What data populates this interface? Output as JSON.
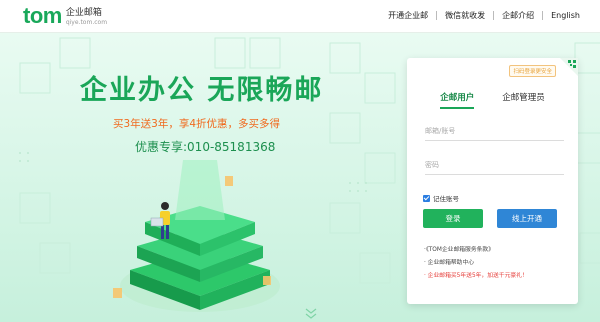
{
  "header": {
    "logo_word": "tom",
    "logo_cn": "企业邮箱",
    "logo_url": "qiye.tom.com",
    "nav": [
      {
        "label": "开通企业邮"
      },
      {
        "label": "微信就收发"
      },
      {
        "label": "企邮介绍"
      },
      {
        "label": "English"
      }
    ]
  },
  "banner": {
    "headline": "企业办公  无限畅邮",
    "promo": "买3年送3年，享4折优惠，多买多得",
    "hotline": "优惠专享:010-85181368"
  },
  "login": {
    "qr_badge": "扫码登录更安全",
    "tabs": [
      {
        "label": "企邮用户",
        "active": true
      },
      {
        "label": "企邮管理员",
        "active": false
      }
    ],
    "account_placeholder": "邮箱/账号",
    "password_placeholder": "密码",
    "remember_label": "记住账号",
    "remember_checked": true,
    "login_button": "登录",
    "open_button": "线上开通",
    "links": [
      {
        "text": "·《TOM企业邮箱服务条款》",
        "color": "#444444"
      },
      {
        "text": "· 企业邮箱帮助中心",
        "color": "#444444"
      },
      {
        "text": "· 企业邮箱买5年送5年，加送千元豪礼！",
        "color": "#e53935"
      }
    ]
  },
  "colors": {
    "brand_green": "#1aa658",
    "promo_orange": "#f06a1e",
    "open_blue": "#2f86d6",
    "login_green": "#21b25c"
  }
}
